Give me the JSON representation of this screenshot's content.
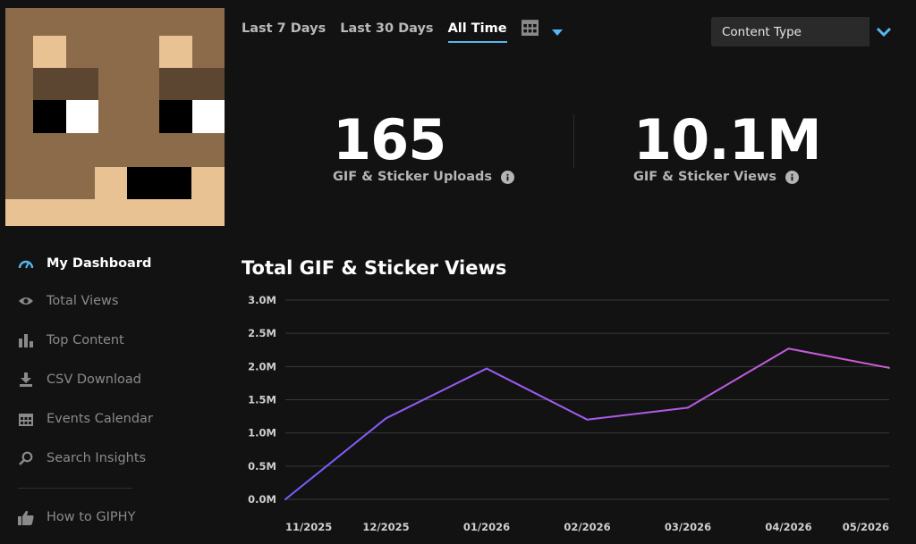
{
  "header": {
    "tabs": [
      {
        "label": "Last 7 Days",
        "active": false
      },
      {
        "label": "Last 30 Days",
        "active": false
      },
      {
        "label": "All Time",
        "active": true
      }
    ],
    "calendar_icon": "calendar-icon",
    "caret_icon": "caret-down-icon",
    "content_type": {
      "label": "Content Type",
      "toggle_icon": "chevron-down-icon"
    }
  },
  "sidebar": {
    "items": [
      {
        "label": "My Dashboard",
        "icon": "gauge-icon",
        "active": true
      },
      {
        "label": "Total Views",
        "icon": "eye-icon",
        "active": false
      },
      {
        "label": "Top Content",
        "icon": "bar-chart-icon",
        "active": false
      },
      {
        "label": "CSV Download",
        "icon": "download-icon",
        "active": false
      },
      {
        "label": "Events Calendar",
        "icon": "calendar-icon",
        "active": false
      },
      {
        "label": "Search Insights",
        "icon": "search-icon",
        "active": false
      },
      {
        "label": "How to GIPHY",
        "icon": "thumbs-up-icon",
        "active": false
      }
    ]
  },
  "stats": {
    "uploads": {
      "value": "165",
      "label": "GIF & Sticker Uploads",
      "icon": "info-icon"
    },
    "views": {
      "value": "10.1M",
      "label": "GIF & Sticker Views",
      "icon": "info-icon"
    }
  },
  "colors": {
    "accent": "#55b7f0",
    "background": "#121212",
    "line_start": "#7c5cff",
    "line_end": "#d15cd6",
    "grid": "#3a3a3a"
  },
  "chart_data": {
    "type": "line",
    "title": "Total GIF & Sticker Views",
    "x": [
      "11/2025",
      "12/2025",
      "01/2026",
      "02/2026",
      "03/2026",
      "04/2026",
      "05/2026"
    ],
    "y_tick_labels": [
      "0.0M",
      "0.5M",
      "1.0M",
      "1.5M",
      "2.0M",
      "2.5M",
      "3.0M"
    ],
    "ylim": [
      0,
      3.0
    ],
    "series": [
      {
        "values": [
          0.0,
          1.22,
          1.97,
          1.2,
          1.38,
          2.27,
          1.98
        ]
      }
    ],
    "grid": true,
    "legend": "none"
  }
}
